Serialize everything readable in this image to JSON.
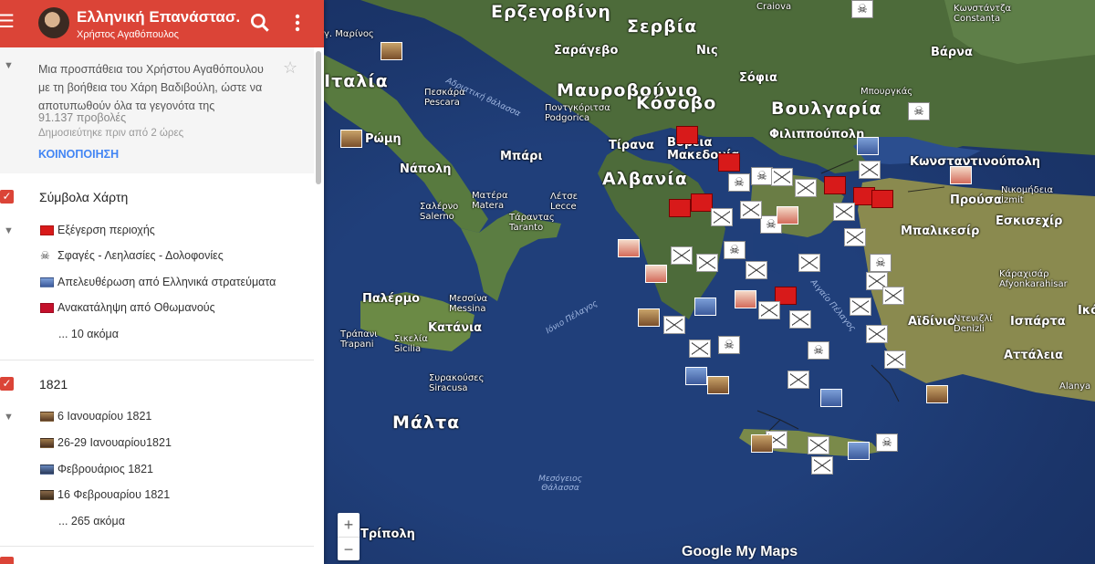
{
  "app": {
    "title": "Ελληνική Επανάστασ...",
    "author": "Χρήστος Αγαθόπουλος"
  },
  "info": {
    "description": "Μια προσπάθεια του Χρήστου Αγαθόπουλου με τη βοήθεια του Χάρη Βαδιβούλη, ώστε να αποτυπωθούν όλα τα γεγονότα της",
    "views": "91.137 προβολές",
    "published": "Δημοσιεύτηκε πριν από 2 ώρες",
    "share_label": "ΚΟΙΝΟΠΟΙΗΣΗ"
  },
  "layers": [
    {
      "name": "Σύμβολα Χάρτη",
      "items": [
        {
          "icon": "red-flag-icon",
          "label": "Εξέγερση περιοχής"
        },
        {
          "icon": "skull-icon",
          "label": "Σφαγές - Λεηλασίες - Δολοφονίες"
        },
        {
          "icon": "greek-flag-icon",
          "label": "Απελευθέρωση από Ελληνικά στρατεύματα"
        },
        {
          "icon": "ottoman-flag-icon",
          "label": "Ανακατάληψη από Οθωμανούς"
        }
      ],
      "more": "... 10 ακόμα"
    },
    {
      "name": "1821",
      "items": [
        {
          "icon": "painting-icon",
          "label": "6 Ιανουαρίου 1821"
        },
        {
          "icon": "painting-icon",
          "label": "26-29 Ιανουαρίου1821"
        },
        {
          "icon": "painting-icon",
          "label": "Φεβρουάριος 1821"
        },
        {
          "icon": "painting-icon",
          "label": "16 Φεβρουαρίου 1821"
        }
      ],
      "more": "... 265 ακόμα"
    }
  ],
  "map": {
    "labels": {
      "big": [
        "Ερζεγοβίνη",
        "Σερβία",
        "Ιταλία",
        "Μαυροβούνιο",
        "Κόσοβο",
        "Βουλγαρία",
        "Βόρεια Μακεδονία",
        "Αλβανία",
        "Μάλτα"
      ],
      "medium": [
        "Κωνσταντινούπολη",
        "Σόφια",
        "Φιλιππούπολη",
        "Προύσα",
        "Εσκισεχίρ",
        "Παλέρμο",
        "Κατάνια",
        "Νάπολη",
        "Μπάρι",
        "Τίρανα",
        "Σαράγεβο",
        "Νις",
        "Βάρνα",
        "Μπαλικεσίρ",
        "Αττάλεια",
        "Ισπάρτα",
        "Τρίπολη",
        "Ρώμη",
        "Αϊδίνιο"
      ],
      "cities": [
        "Πεσκάρα Pescara",
        "Σαλέρνο Salerno",
        "Μεσσίνα Messina",
        "Συρακούσες Siracusa",
        "Ποντγκόριτσα Podgorica",
        "Λέτσε Lecce",
        "Τάραντας Taranto",
        "Ματέρα Matera",
        "Τράπανι Trapani",
        "Σικελία Sicilia",
        "Μπουργκάς",
        "Κωνστάντζα Constanța",
        "Νικομήδεια İzmit",
        "Ντενιζλί Denizli",
        "Κάραχισάρ Afyonkarahisar"
      ],
      "seas": [
        "Αδριατική θάλασσα",
        "Ιόνιο Πέλαγος",
        "Αιγαίο Πέλαγος",
        "Μεσόγειος Θάλασσα"
      ],
      "partial": [
        "γ. Μαρίνος",
        "Craiova",
        "Ικό",
        "Alanya"
      ]
    },
    "zoom_in": "+",
    "zoom_out": "−",
    "logo": "Google My Maps"
  }
}
